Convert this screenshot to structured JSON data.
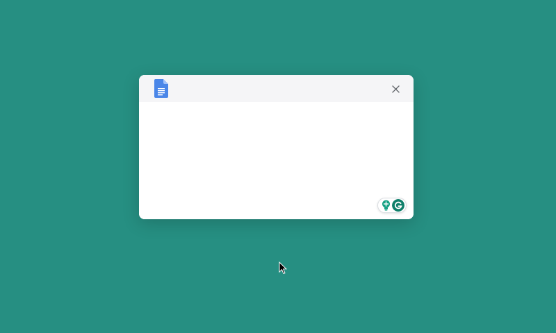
{
  "dialog": {
    "header_icon": "google-docs-icon",
    "close_icon": "close-icon",
    "body_text": ""
  },
  "grammarly": {
    "suggestion_icon": "lightbulb-icon",
    "logo_icon": "grammarly-g-icon"
  },
  "colors": {
    "background": "#268f82",
    "header_bg": "#f5f5f7",
    "docs_blue": "#4a86e8",
    "grammarly_green": "#15a083",
    "grammarly_dark": "#0f7f6a"
  },
  "pointer": {
    "icon": "mouse-pointer-icon"
  }
}
